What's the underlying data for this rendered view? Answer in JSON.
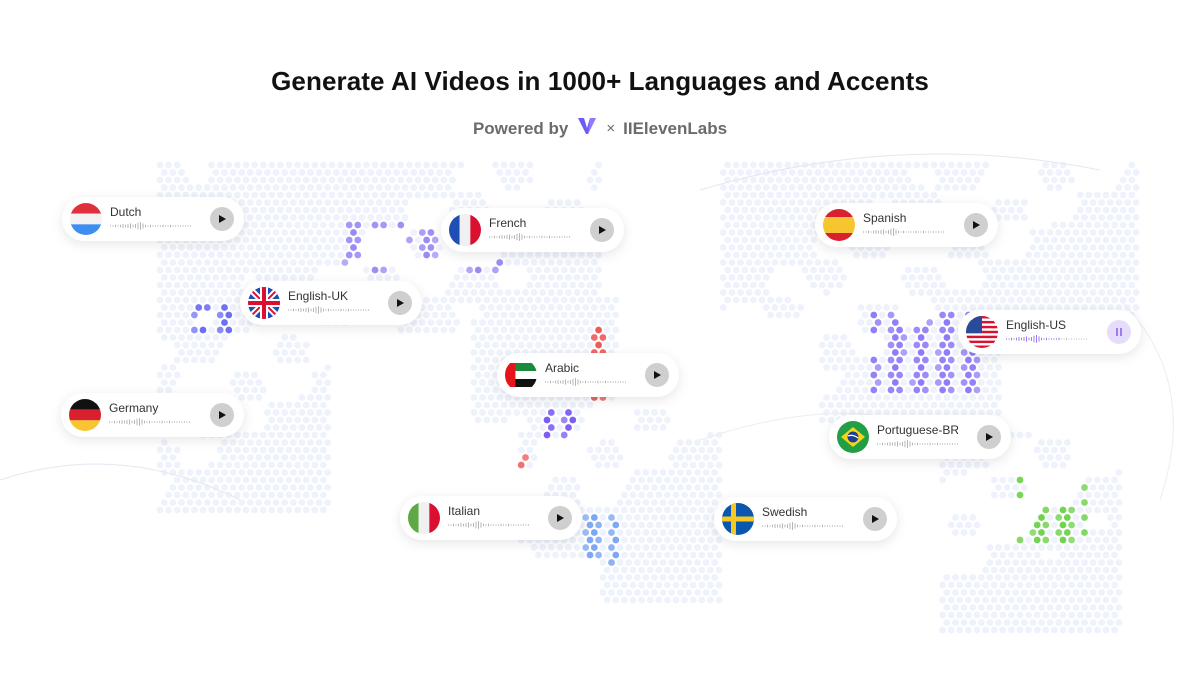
{
  "header": {
    "title": "Generate AI Videos in 1000+ Languages and Accents",
    "powered_by": "Powered by",
    "times": "×",
    "partner": "IIElevenLabs",
    "logo_icon": "v-logo-icon"
  },
  "colors": {
    "accent_purple": "#6b5cf6",
    "map_base": "#eef2fc",
    "playing": "#a07af0"
  },
  "cards": [
    {
      "id": "dutch",
      "label": "Dutch",
      "state": "paused-ready"
    },
    {
      "id": "french",
      "label": "French",
      "state": "paused-ready"
    },
    {
      "id": "spanish",
      "label": "Spanish",
      "state": "paused-ready"
    },
    {
      "id": "english-uk",
      "label": "English-UK",
      "state": "paused-ready"
    },
    {
      "id": "english-us",
      "label": "English-US",
      "state": "playing"
    },
    {
      "id": "arabic",
      "label": "Arabic",
      "state": "paused-ready"
    },
    {
      "id": "germany",
      "label": "Germany",
      "state": "paused-ready"
    },
    {
      "id": "portuguese-br",
      "label": "Portuguese-BR",
      "state": "paused-ready"
    },
    {
      "id": "italian",
      "label": "Italian",
      "state": "paused-ready"
    },
    {
      "id": "swedish",
      "label": "Swedish",
      "state": "paused-ready"
    }
  ]
}
